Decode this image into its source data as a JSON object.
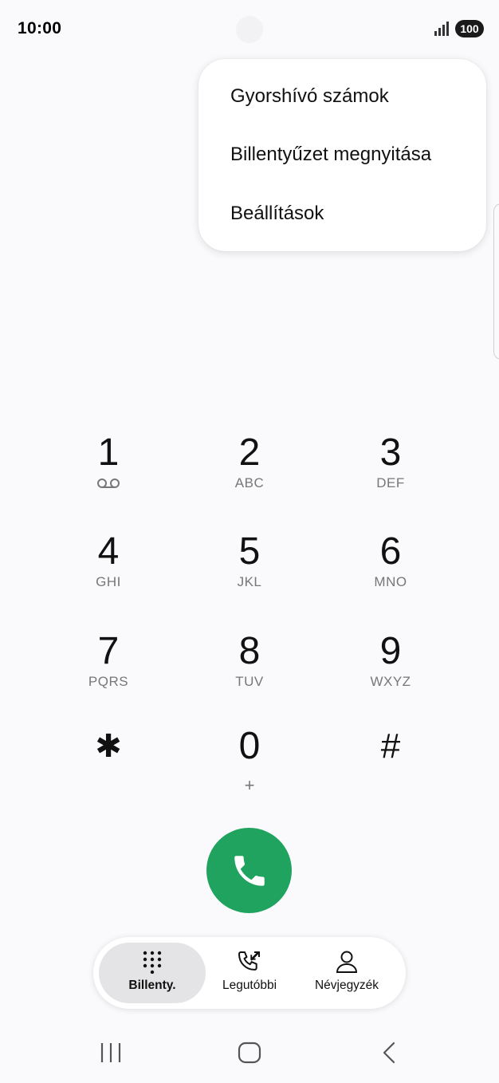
{
  "status_bar": {
    "time": "10:00",
    "battery": "100",
    "icons": [
      "signal-icon",
      "battery-icon"
    ]
  },
  "menu": {
    "items": [
      {
        "label": "Gyorshívó számok"
      },
      {
        "label": "Billentyűzet megnyitása"
      },
      {
        "label": "Beállítások"
      }
    ]
  },
  "keypad": {
    "keys": [
      {
        "digit": "1",
        "letters": ""
      },
      {
        "digit": "2",
        "letters": "ABC"
      },
      {
        "digit": "3",
        "letters": "DEF"
      },
      {
        "digit": "4",
        "letters": "GHI"
      },
      {
        "digit": "5",
        "letters": "JKL"
      },
      {
        "digit": "6",
        "letters": "MNO"
      },
      {
        "digit": "7",
        "letters": "PQRS"
      },
      {
        "digit": "8",
        "letters": "TUV"
      },
      {
        "digit": "9",
        "letters": "WXYZ"
      },
      {
        "digit": "✱",
        "letters": ""
      },
      {
        "digit": "0",
        "letters": "+"
      },
      {
        "digit": "#",
        "letters": ""
      }
    ]
  },
  "call": {
    "icon": "phone-icon",
    "color": "#20a35f"
  },
  "bottom_nav": {
    "tabs": [
      {
        "label": "Billenty.",
        "icon": "keypad-icon",
        "active": true
      },
      {
        "label": "Legutóbbi",
        "icon": "recent-calls-icon",
        "active": false
      },
      {
        "label": "Névjegyzék",
        "icon": "contacts-icon",
        "active": false
      }
    ]
  },
  "system_nav": {
    "icons": [
      "recent-apps-icon",
      "home-icon",
      "back-icon"
    ]
  }
}
